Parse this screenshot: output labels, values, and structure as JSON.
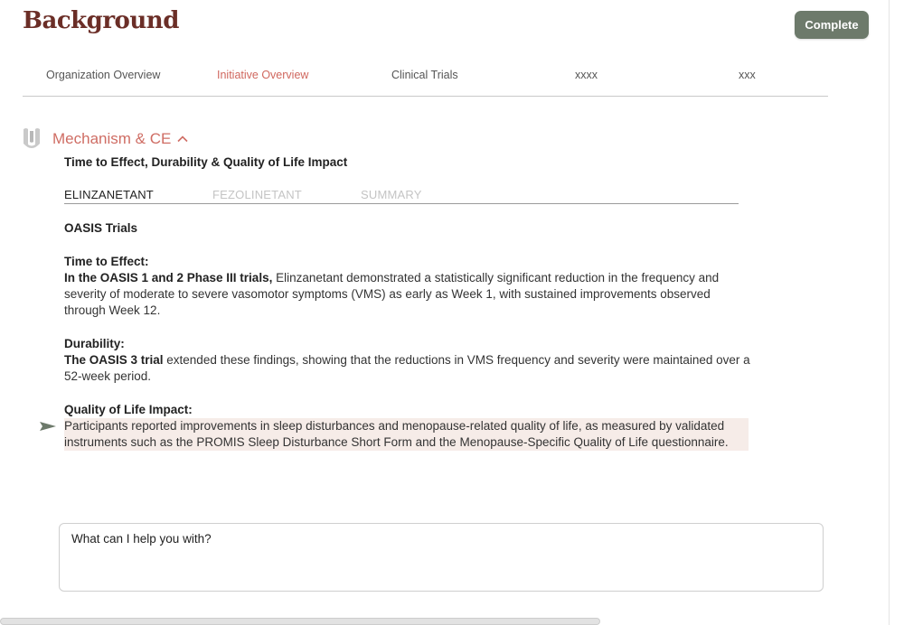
{
  "header": {
    "title": "Background",
    "complete_label": "Complete"
  },
  "top_tabs": [
    {
      "label": "Organization Overview",
      "active": false
    },
    {
      "label": "Initiative Overview",
      "active": true
    },
    {
      "label": "Clinical Trials",
      "active": false
    },
    {
      "label": "xxxx",
      "active": false
    },
    {
      "label": "xxx",
      "active": false
    }
  ],
  "section": {
    "title": "Mechanism & CE",
    "subtitle": "Time to Effect, Durability & Quality of Life Impact",
    "accent_color": "#cf6d64"
  },
  "drug_tabs": [
    {
      "label": "ELINZANETANT",
      "active": true
    },
    {
      "label": "FEZOLINETANT",
      "active": false
    },
    {
      "label": "SUMMARY",
      "active": false
    }
  ],
  "content": {
    "trials_heading": "OASIS Trials",
    "time_to_effect": {
      "heading": "Time to Effect:",
      "lead": "In the OASIS 1 and 2 Phase III trials,",
      "body": " Elinzanetant demonstrated a statistically significant reduction in the frequency and severity of moderate to severe vasomotor symptoms (VMS) as early as Week 1, with sustained improvements observed through Week 12."
    },
    "durability": {
      "heading": "Durability:",
      "lead": "The OASIS 3 trial",
      "body": " extended these findings, showing that the reductions in VMS frequency and severity were maintained over a 52-week period."
    },
    "quality_of_life": {
      "heading": "Quality of Life Impact:",
      "body": "Participants reported improvements in sleep disturbances and menopause-related quality of life, as measured by validated instruments such as the PROMIS Sleep Disturbance Short Form and the Menopause-Specific Quality of Life questionnaire."
    }
  },
  "chat": {
    "placeholder": "What can I help you with?"
  },
  "colors": {
    "title": "#6b2e27",
    "button_bg": "#6d7a6b",
    "highlight_bg": "#f6ece8",
    "active_tab": "#d0675e"
  }
}
